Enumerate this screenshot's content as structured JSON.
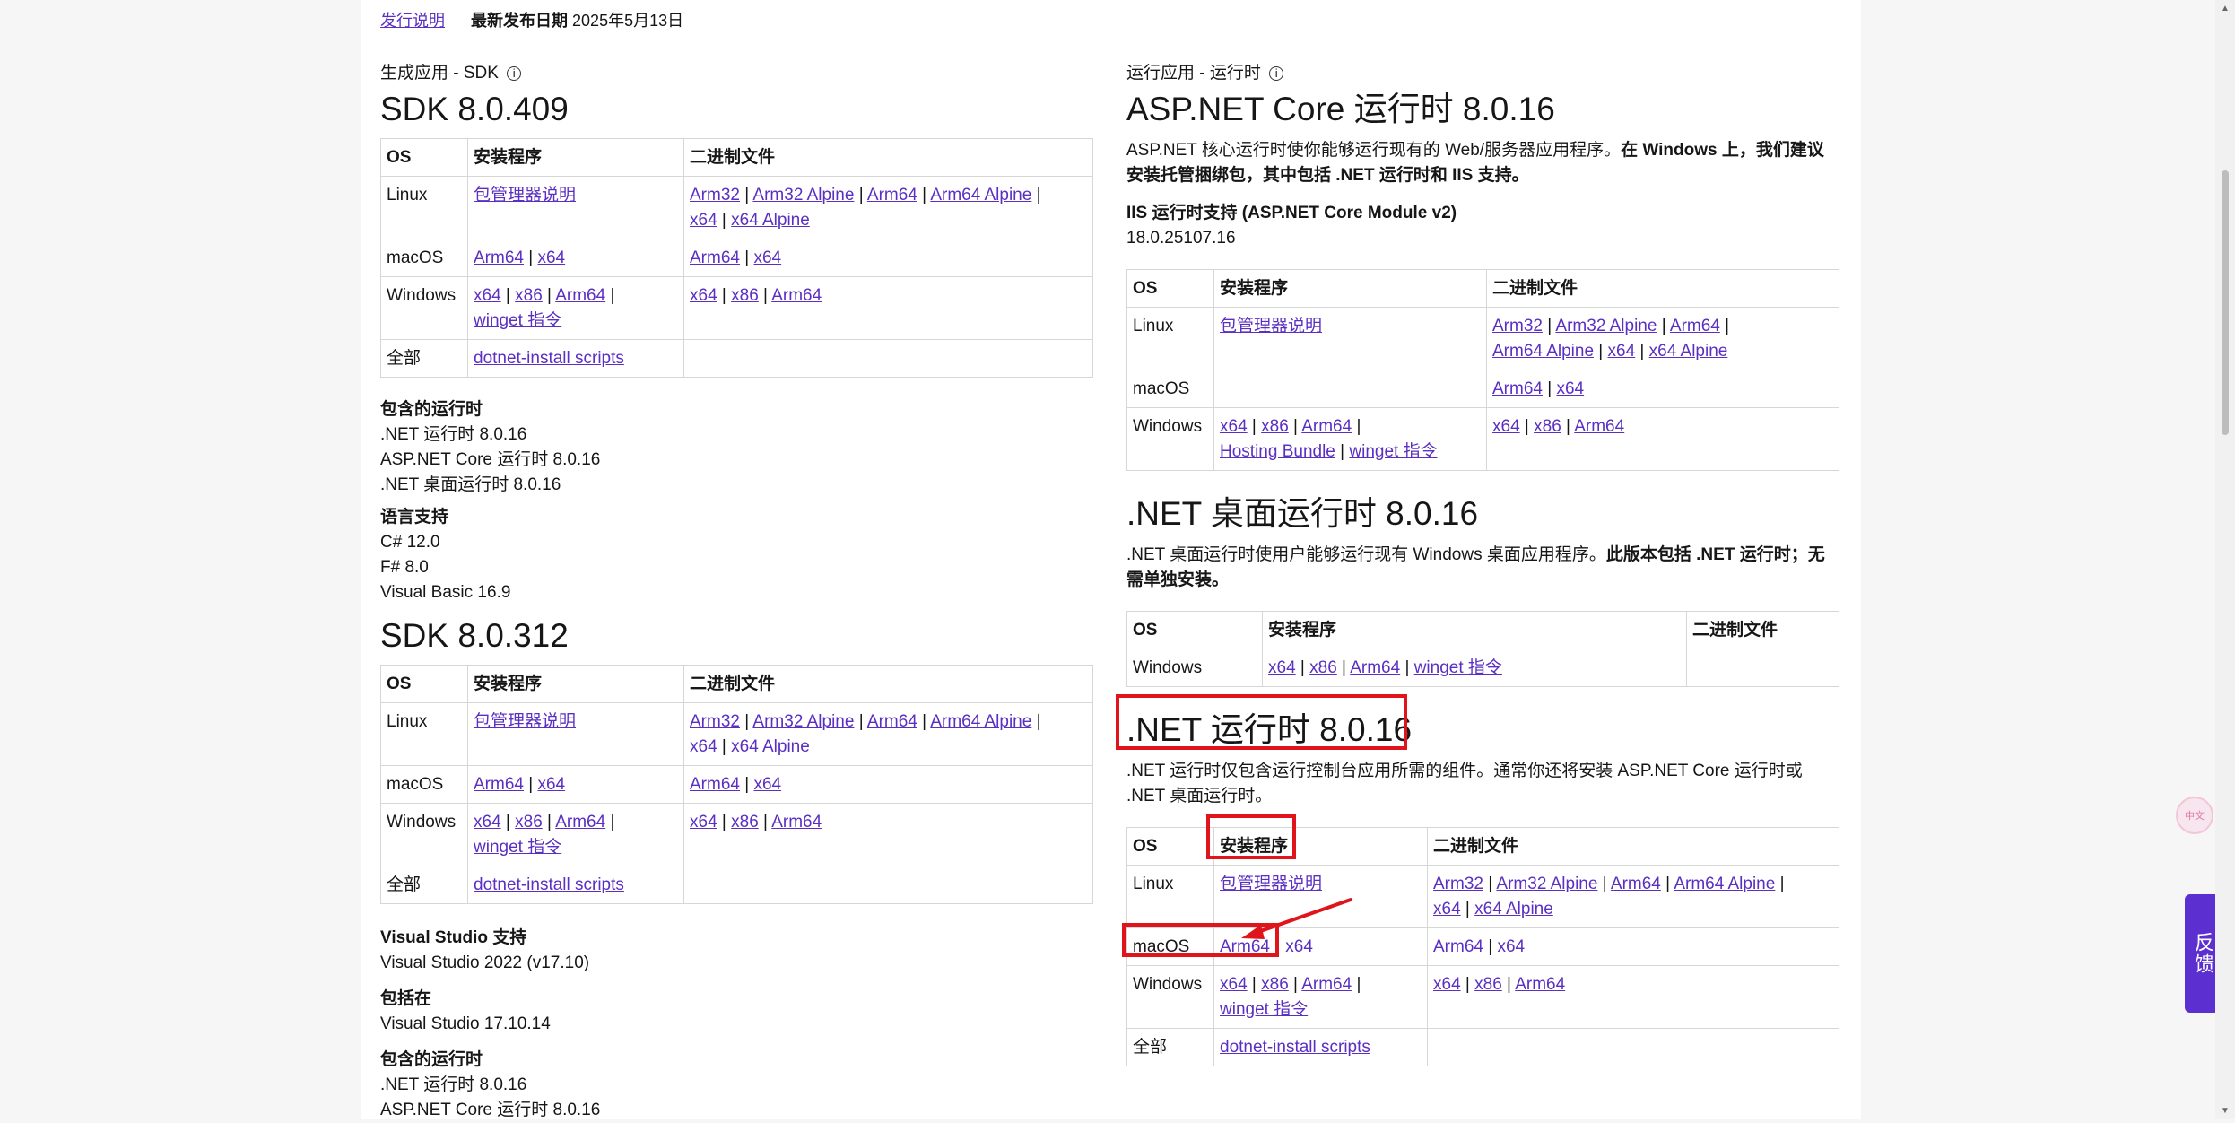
{
  "top": {
    "release_notes": "发行说明",
    "latest_label": "最新发布日期",
    "latest_date": "2025年5月13日"
  },
  "sdk409": {
    "kicker": "生成应用 - SDK",
    "title": "SDK 8.0.409",
    "headers": [
      "OS",
      "安装程序",
      "二进制文件"
    ],
    "rows": {
      "linux": {
        "os": "Linux",
        "inst": [
          "包管理器说明"
        ],
        "bin": [
          "Arm32",
          "Arm32 Alpine",
          "Arm64",
          "Arm64 Alpine",
          "x64",
          "x64 Alpine"
        ]
      },
      "macos": {
        "os": "macOS",
        "inst": [
          "Arm64",
          "x64"
        ],
        "bin": [
          "Arm64",
          "x64"
        ]
      },
      "windows": {
        "os": "Windows",
        "inst": [
          "x64",
          "x86",
          "Arm64",
          "winget 指令"
        ],
        "bin": [
          "x64",
          "x86",
          "Arm64"
        ]
      },
      "all": {
        "os": "全部",
        "inst": [
          "dotnet-install scripts"
        ]
      }
    },
    "runtimes_title": "包含的运行时",
    "runtimes": [
      ".NET 运行时 8.0.16",
      "ASP.NET Core 运行时 8.0.16",
      ".NET 桌面运行时 8.0.16"
    ],
    "lang_title": "语言支持",
    "langs": [
      "C# 12.0",
      "F# 8.0",
      "Visual Basic 16.9"
    ]
  },
  "sdk312": {
    "title": "SDK 8.0.312",
    "headers": [
      "OS",
      "安装程序",
      "二进制文件"
    ],
    "rows": {
      "linux": {
        "os": "Linux",
        "inst": [
          "包管理器说明"
        ],
        "bin": [
          "Arm32",
          "Arm32 Alpine",
          "Arm64",
          "Arm64 Alpine",
          "x64",
          "x64 Alpine"
        ]
      },
      "macos": {
        "os": "macOS",
        "inst": [
          "Arm64",
          "x64"
        ],
        "bin": [
          "Arm64",
          "x64"
        ]
      },
      "windows": {
        "os": "Windows",
        "inst": [
          "x64",
          "x86",
          "Arm64",
          "winget 指令"
        ],
        "bin": [
          "x64",
          "x86",
          "Arm64"
        ]
      },
      "all": {
        "os": "全部",
        "inst": [
          "dotnet-install scripts"
        ]
      }
    },
    "vs_title": "Visual Studio 支持",
    "vs": "Visual Studio 2022 (v17.10)",
    "included_title": "包括在",
    "included": "Visual Studio 17.10.14",
    "runtimes_title": "包含的运行时",
    "runtimes": [
      ".NET 运行时 8.0.16",
      "ASP.NET Core 运行时 8.0.16"
    ]
  },
  "aspnet": {
    "kicker": "运行应用 - 运行时",
    "title": "ASP.NET Core 运行时 8.0.16",
    "desc_normal": "ASP.NET 核心运行时使你能够运行现有的 Web/服务器应用程序。",
    "desc_bold": "在 Windows 上，我们建议安装托管捆绑包，其中包括 .NET 运行时和 IIS 支持。",
    "iis_title": "IIS 运行时支持 (ASP.NET Core Module v2)",
    "iis_version": "18.0.25107.16",
    "headers": [
      "OS",
      "安装程序",
      "二进制文件"
    ],
    "rows": {
      "linux": {
        "os": "Linux",
        "inst": [
          "包管理器说明"
        ],
        "bin": [
          "Arm32",
          "Arm32 Alpine",
          "Arm64",
          "Arm64 Alpine",
          "x64",
          "x64 Alpine"
        ]
      },
      "macos": {
        "os": "macOS",
        "bin": [
          "Arm64",
          "x64"
        ]
      },
      "windows": {
        "os": "Windows",
        "inst": [
          "x64",
          "x86",
          "Arm64",
          "Hosting Bundle",
          "winget 指令"
        ],
        "bin": [
          "x64",
          "x86",
          "Arm64"
        ]
      }
    }
  },
  "desktop": {
    "title": ".NET 桌面运行时 8.0.16",
    "desc_normal": ".NET 桌面运行时使用户能够运行现有 Windows 桌面应用程序。",
    "desc_bold": "此版本包括 .NET 运行时；无需单独安装。",
    "headers": [
      "OS",
      "安装程序",
      "二进制文件"
    ],
    "rows": {
      "windows": {
        "os": "Windows",
        "inst": [
          "x64",
          "x86",
          "Arm64",
          "winget 指令"
        ]
      }
    }
  },
  "netrt": {
    "title": ".NET 运行时 8.0.16",
    "desc": ".NET 运行时仅包含运行控制台应用所需的组件。通常你还将安装 ASP.NET Core 运行时或 .NET 桌面运行时。",
    "headers": [
      "OS",
      "安装程序",
      "二进制文件"
    ],
    "rows": {
      "linux": {
        "os": "Linux",
        "inst": [
          "包管理器说明"
        ],
        "bin": [
          "Arm32",
          "Arm32 Alpine",
          "Arm64",
          "Arm64 Alpine",
          "x64",
          "x64 Alpine"
        ]
      },
      "macos": {
        "os": "macOS",
        "inst": [
          "Arm64",
          "x64"
        ],
        "bin": [
          "Arm64",
          "x64"
        ]
      },
      "windows": {
        "os": "Windows",
        "inst": [
          "x64",
          "x86",
          "Arm64",
          "winget 指令"
        ],
        "bin": [
          "x64",
          "x86",
          "Arm64"
        ]
      },
      "all": {
        "os": "全部",
        "inst": [
          "dotnet-install scripts"
        ]
      }
    }
  },
  "ui": {
    "feedback": "反馈",
    "chat": "中文",
    "highlight_color": "#e0141b",
    "link_color": "#5a2fc2",
    "feedback_color": "#5b2fd0"
  }
}
